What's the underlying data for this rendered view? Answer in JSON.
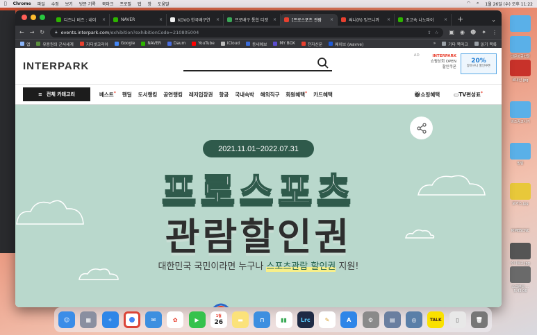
{
  "menubar": {
    "app": "Chrome",
    "items": [
      "파일",
      "수정",
      "보기",
      "방문 기록",
      "북마크",
      "프로필",
      "탭",
      "창",
      "도움말"
    ],
    "clock": "1월 26일 (수) 오후 11:22"
  },
  "browser": {
    "tabs": [
      {
        "label": "디즈니 버즈 : 네이",
        "color": "#2db400"
      },
      {
        "label": "NAVER",
        "color": "#2db400"
      },
      {
        "label": "KOVO 한국배구연",
        "color": "#f0f0f0"
      },
      {
        "label": "프로배구 통합 티켓",
        "color": "#3aa757"
      },
      {
        "label": "[프로스포츠 관람",
        "color": "#e8402f",
        "active": true
      },
      {
        "label": "써니(R) 믿으니까",
        "color": "#e8402f"
      },
      {
        "label": "초고속 나노파이",
        "color": "#2db400"
      }
    ],
    "url_domain": "events.interpark.com",
    "url_path": "/exhibition?exhibitionCode=210805004",
    "bookmarks": [
      {
        "label": "앱",
        "color": "#8ab4f8"
      },
      {
        "label": "유용원의 군사세계",
        "color": "#5b8f3e"
      },
      {
        "label": "지디넷코리아",
        "color": "#e8402f"
      },
      {
        "label": "Google",
        "color": "#4285f4"
      },
      {
        "label": "NAVER",
        "color": "#2db400"
      },
      {
        "label": "Daum",
        "color": "#4a6ee0"
      },
      {
        "label": "YouTube",
        "color": "#ff0000"
      },
      {
        "label": "iCloud",
        "color": "#bbbbbb"
      },
      {
        "label": "동네예보",
        "color": "#3a6bd8"
      },
      {
        "label": "MY BOX",
        "color": "#5b4ccf"
      },
      {
        "label": "전자신문",
        "color": "#e8402f"
      },
      {
        "label": "웨이브 (wavve)",
        "color": "#1e5bd8"
      }
    ],
    "bookmarks_other": "기타 북마크",
    "bookmarks_reading": "읽기 목록",
    "more": "»"
  },
  "site": {
    "logo": "INTERPARK",
    "ad": {
      "tag": "AD",
      "brand": "INTERPARK",
      "line1": "쇼핑상회 OPEN",
      "line2": "할인쿠폰",
      "coupon_pct": "20%",
      "coupon_sub": "장바구니 할인쿠폰"
    },
    "category_button": "전체 카테고리",
    "nav": [
      {
        "label": "베스트",
        "star": true
      },
      {
        "label": "핸딜"
      },
      {
        "label": "도서랭킹"
      },
      {
        "label": "공연랭킹"
      },
      {
        "label": "레저입장권"
      },
      {
        "label": "항공"
      },
      {
        "label": "국내숙박"
      },
      {
        "label": "해외직구"
      },
      {
        "label": "회원혜택",
        "star": true
      },
      {
        "label": "카드혜택"
      }
    ],
    "nav_right": [
      {
        "label": "쇼핑혜택"
      },
      {
        "label": "TV편성표",
        "star": true
      }
    ],
    "star": "*"
  },
  "banner": {
    "date": "2021.11.01~2022.07.31",
    "title1": "프로스포츠",
    "title2": "관람할인권",
    "sub_before": "대한민국 국민이라면 누구나 ",
    "sub_highlight": "스포츠관람 할인권",
    "sub_after": " 지원!"
  },
  "desktop_items": [
    "대문화공학탈",
    "르내신.jpg",
    "비즈중고사기",
    "빌린",
    "모거스.jpg",
    "KIMBSCNC",
    "수이트고.jpg",
    "스크린샷 ... 5.43.06"
  ],
  "dock_calendar_month": "1월",
  "dock_calendar_day": "26"
}
